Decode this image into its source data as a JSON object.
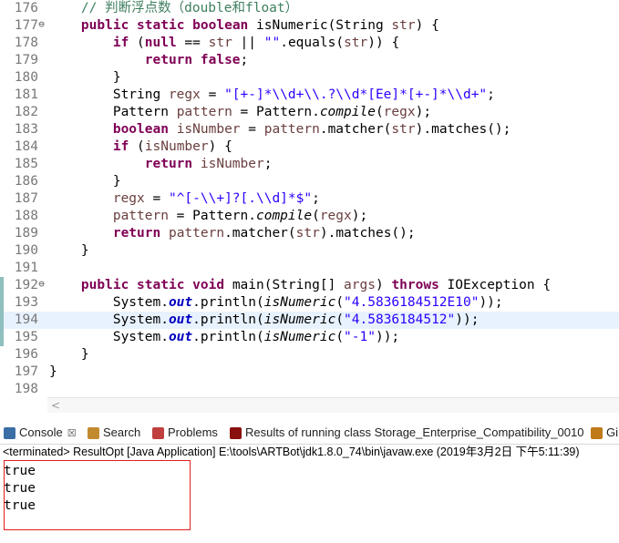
{
  "editor": {
    "lines": [
      {
        "num": "176",
        "segs": [
          {
            "t": "    ",
            "c": ""
          },
          {
            "t": "// 判断浮点数（double和float）",
            "c": "cm"
          }
        ]
      },
      {
        "num": "177",
        "fold": "⊖",
        "segs": [
          {
            "t": "    ",
            "c": ""
          },
          {
            "t": "public",
            "c": "kw"
          },
          {
            "t": " ",
            "c": ""
          },
          {
            "t": "static",
            "c": "kw"
          },
          {
            "t": " ",
            "c": ""
          },
          {
            "t": "boolean",
            "c": "kw"
          },
          {
            "t": " isNumeric(String ",
            "c": ""
          },
          {
            "t": "str",
            "c": "lv"
          },
          {
            "t": ") {",
            "c": ""
          }
        ]
      },
      {
        "num": "178",
        "segs": [
          {
            "t": "        ",
            "c": ""
          },
          {
            "t": "if",
            "c": "kw"
          },
          {
            "t": " (",
            "c": ""
          },
          {
            "t": "null",
            "c": "kw"
          },
          {
            "t": " == ",
            "c": ""
          },
          {
            "t": "str",
            "c": "lv"
          },
          {
            "t": " || ",
            "c": ""
          },
          {
            "t": "\"\"",
            "c": "str"
          },
          {
            "t": ".equals(",
            "c": ""
          },
          {
            "t": "str",
            "c": "lv"
          },
          {
            "t": ")) {",
            "c": ""
          }
        ]
      },
      {
        "num": "179",
        "segs": [
          {
            "t": "            ",
            "c": ""
          },
          {
            "t": "return",
            "c": "kw"
          },
          {
            "t": " ",
            "c": ""
          },
          {
            "t": "false",
            "c": "kw"
          },
          {
            "t": ";",
            "c": ""
          }
        ]
      },
      {
        "num": "180",
        "segs": [
          {
            "t": "        }",
            "c": ""
          }
        ]
      },
      {
        "num": "181",
        "segs": [
          {
            "t": "        String ",
            "c": ""
          },
          {
            "t": "regx",
            "c": "lv"
          },
          {
            "t": " = ",
            "c": ""
          },
          {
            "t": "\"[+-]*\\\\d+\\\\.?\\\\d*[Ee]*[+-]*\\\\d+\"",
            "c": "str"
          },
          {
            "t": ";",
            "c": ""
          }
        ]
      },
      {
        "num": "182",
        "segs": [
          {
            "t": "        Pattern ",
            "c": ""
          },
          {
            "t": "pattern",
            "c": "lv"
          },
          {
            "t": " = Pattern.",
            "c": ""
          },
          {
            "t": "compile",
            "c": "it"
          },
          {
            "t": "(",
            "c": ""
          },
          {
            "t": "regx",
            "c": "lv"
          },
          {
            "t": ");",
            "c": ""
          }
        ]
      },
      {
        "num": "183",
        "segs": [
          {
            "t": "        ",
            "c": ""
          },
          {
            "t": "boolean",
            "c": "kw"
          },
          {
            "t": " ",
            "c": ""
          },
          {
            "t": "isNumber",
            "c": "lv"
          },
          {
            "t": " = ",
            "c": ""
          },
          {
            "t": "pattern",
            "c": "lv"
          },
          {
            "t": ".matcher(",
            "c": ""
          },
          {
            "t": "str",
            "c": "lv"
          },
          {
            "t": ").matches();",
            "c": ""
          }
        ]
      },
      {
        "num": "184",
        "segs": [
          {
            "t": "        ",
            "c": ""
          },
          {
            "t": "if",
            "c": "kw"
          },
          {
            "t": " (",
            "c": ""
          },
          {
            "t": "isNumber",
            "c": "lv"
          },
          {
            "t": ") {",
            "c": ""
          }
        ]
      },
      {
        "num": "185",
        "segs": [
          {
            "t": "            ",
            "c": ""
          },
          {
            "t": "return",
            "c": "kw"
          },
          {
            "t": " ",
            "c": ""
          },
          {
            "t": "isNumber",
            "c": "lv"
          },
          {
            "t": ";",
            "c": ""
          }
        ]
      },
      {
        "num": "186",
        "segs": [
          {
            "t": "        }",
            "c": ""
          }
        ]
      },
      {
        "num": "187",
        "segs": [
          {
            "t": "        ",
            "c": ""
          },
          {
            "t": "regx",
            "c": "lv"
          },
          {
            "t": " = ",
            "c": ""
          },
          {
            "t": "\"^[-\\\\+]?[.\\\\d]*$\"",
            "c": "str"
          },
          {
            "t": ";",
            "c": ""
          }
        ]
      },
      {
        "num": "188",
        "segs": [
          {
            "t": "        ",
            "c": ""
          },
          {
            "t": "pattern",
            "c": "lv"
          },
          {
            "t": " = Pattern.",
            "c": ""
          },
          {
            "t": "compile",
            "c": "it"
          },
          {
            "t": "(",
            "c": ""
          },
          {
            "t": "regx",
            "c": "lv"
          },
          {
            "t": ");",
            "c": ""
          }
        ]
      },
      {
        "num": "189",
        "segs": [
          {
            "t": "        ",
            "c": ""
          },
          {
            "t": "return",
            "c": "kw"
          },
          {
            "t": " ",
            "c": ""
          },
          {
            "t": "pattern",
            "c": "lv"
          },
          {
            "t": ".matcher(",
            "c": ""
          },
          {
            "t": "str",
            "c": "lv"
          },
          {
            "t": ").matches();",
            "c": ""
          }
        ]
      },
      {
        "num": "190",
        "segs": [
          {
            "t": "    }",
            "c": ""
          }
        ]
      },
      {
        "num": "191",
        "segs": []
      },
      {
        "num": "192",
        "fold": "⊖",
        "marker": true,
        "segs": [
          {
            "t": "    ",
            "c": ""
          },
          {
            "t": "public",
            "c": "kw"
          },
          {
            "t": " ",
            "c": ""
          },
          {
            "t": "static",
            "c": "kw"
          },
          {
            "t": " ",
            "c": ""
          },
          {
            "t": "void",
            "c": "kw"
          },
          {
            "t": " main(String[] ",
            "c": ""
          },
          {
            "t": "args",
            "c": "lv"
          },
          {
            "t": ") ",
            "c": ""
          },
          {
            "t": "throws",
            "c": "kw"
          },
          {
            "t": " IOException {",
            "c": ""
          }
        ]
      },
      {
        "num": "193",
        "marker": true,
        "segs": [
          {
            "t": "        System.",
            "c": ""
          },
          {
            "t": "out",
            "c": "fld"
          },
          {
            "t": ".println(",
            "c": ""
          },
          {
            "t": "isNumeric",
            "c": "it"
          },
          {
            "t": "(",
            "c": ""
          },
          {
            "t": "\"4.5836184512E10\"",
            "c": "str"
          },
          {
            "t": "));",
            "c": ""
          }
        ]
      },
      {
        "num": "194",
        "marker": true,
        "current": true,
        "segs": [
          {
            "t": "        System.",
            "c": ""
          },
          {
            "t": "out",
            "c": "fld"
          },
          {
            "t": ".println(",
            "c": ""
          },
          {
            "t": "isNumeric",
            "c": "it"
          },
          {
            "t": "(",
            "c": ""
          },
          {
            "t": "\"4.5836184512\"",
            "c": "str"
          },
          {
            "t": "));",
            "c": ""
          }
        ]
      },
      {
        "num": "195",
        "marker": true,
        "segs": [
          {
            "t": "        System.",
            "c": ""
          },
          {
            "t": "out",
            "c": "fld"
          },
          {
            "t": ".println(",
            "c": ""
          },
          {
            "t": "isNumeric",
            "c": "it"
          },
          {
            "t": "(",
            "c": ""
          },
          {
            "t": "\"-1\"",
            "c": "str"
          },
          {
            "t": "));",
            "c": ""
          }
        ]
      },
      {
        "num": "196",
        "segs": [
          {
            "t": "    }",
            "c": ""
          }
        ]
      },
      {
        "num": "197",
        "segs": [
          {
            "t": "}",
            "c": ""
          }
        ]
      },
      {
        "num": "198",
        "segs": []
      }
    ],
    "scroll_left_arrow": "<"
  },
  "tabs": [
    {
      "label": "Console",
      "close": "☒",
      "icon": "console-icon",
      "active": true
    },
    {
      "label": "Search",
      "icon": "search-icon"
    },
    {
      "label": "Problems",
      "icon": "problems-icon"
    },
    {
      "label": "Results of running class Storage_Enterprise_Compatibility_0010",
      "icon": "junit-results-icon"
    },
    {
      "label": "Gi",
      "icon": "git-icon"
    }
  ],
  "console": {
    "status": "<terminated> ResultOpt [Java Application] E:\\tools\\ARTBot\\jdk1.8.0_74\\bin\\javaw.exe (2019年3月2日 下午5:11:39)",
    "output": [
      "true",
      "true",
      "true"
    ]
  },
  "colors": {
    "keyword": "#7f0055",
    "string": "#2a00ff",
    "comment": "#3f7f5f",
    "local_var": "#6a3e3e",
    "field": "#0000c0",
    "current_line": "#e8f2fe",
    "highlight_box": "#e02020"
  }
}
